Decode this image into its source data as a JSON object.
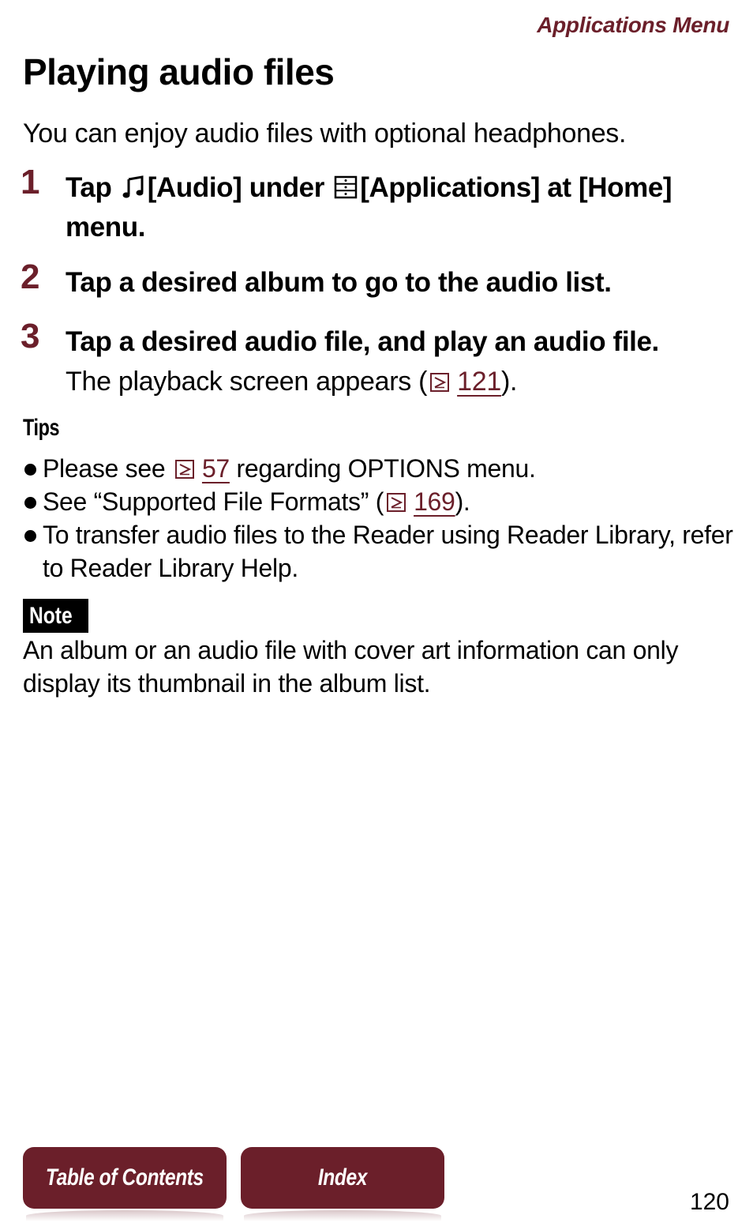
{
  "header": {
    "section": "Applications Menu"
  },
  "title": "Playing audio files",
  "intro": "You can enjoy audio files with optional headphones.",
  "steps": [
    {
      "number": "1",
      "parts": {
        "tap": "Tap",
        "audio": "[Audio] under",
        "apps": "[Applications] at [Home] menu."
      },
      "icons": [
        "music-note-icon",
        "applications-icon"
      ]
    },
    {
      "number": "2",
      "text": "Tap a desired album to go to the audio list."
    },
    {
      "number": "3",
      "text": "Tap a desired audio file, and play an audio file.",
      "sub": {
        "before": "The playback screen appears (",
        "link": "121",
        "after": ")."
      }
    }
  ],
  "tips": {
    "heading": "Tips",
    "items": [
      {
        "before": "Please see",
        "link": "57",
        "after": "regarding OPTIONS menu."
      },
      {
        "before": "See “Supported File Formats” (",
        "link": "169",
        "after": ")."
      },
      {
        "text": "To transfer audio files to the Reader using Reader Library, refer to Reader Library Help."
      }
    ]
  },
  "note": {
    "label": "Note",
    "text": "An album or an audio file with cover art information can only display its thumbnail in the album list."
  },
  "footer": {
    "toc_label": "Table of Contents",
    "index_label": "Index",
    "page_number": "120"
  },
  "colors": {
    "accent": "#6b1f2a",
    "text": "#000000",
    "background": "#ffffff"
  }
}
